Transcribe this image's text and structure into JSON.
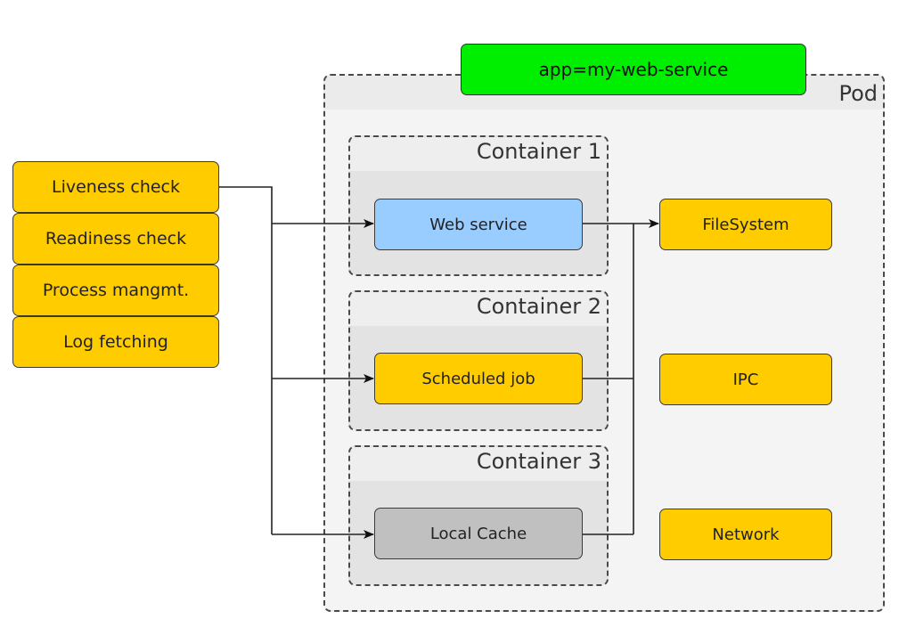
{
  "pod": {
    "label": "Pod",
    "app_label": "app=my-web-service"
  },
  "probes": [
    {
      "label": "Liveness check"
    },
    {
      "label": "Readiness check"
    },
    {
      "label": "Process mangmt."
    },
    {
      "label": "Log fetching"
    }
  ],
  "containers": [
    {
      "title": "Container 1",
      "process": "Web service",
      "color": "#99ccff"
    },
    {
      "title": "Container 2",
      "process": "Scheduled job",
      "color": "#ffcc00"
    },
    {
      "title": "Container 3",
      "process": "Local Cache",
      "color": "#c0c0c0"
    }
  ],
  "resources": [
    {
      "label": "FileSystem"
    },
    {
      "label": "IPC"
    },
    {
      "label": "Network"
    }
  ],
  "colors": {
    "label_green": "#00ee00",
    "probe_yellow": "#ffcc00",
    "web_blue": "#99ccff",
    "cache_grey": "#c0c0c0"
  }
}
